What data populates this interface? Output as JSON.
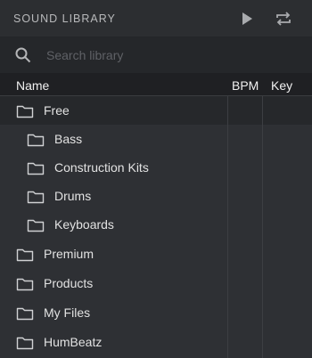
{
  "header": {
    "title": "SOUND LIBRARY"
  },
  "search": {
    "placeholder": "Search library",
    "value": ""
  },
  "columns": {
    "name": "Name",
    "bpm": "BPM",
    "key": "Key"
  },
  "rows": [
    {
      "label": "Free",
      "level": 0,
      "selected": true
    },
    {
      "label": "Bass",
      "level": 1
    },
    {
      "label": "Construction Kits",
      "level": 1
    },
    {
      "label": "Drums",
      "level": 1
    },
    {
      "label": "Keyboards",
      "level": 1
    },
    {
      "label": "Premium",
      "level": 0
    },
    {
      "label": "Products",
      "level": 0
    },
    {
      "label": "My Files",
      "level": 0
    },
    {
      "label": "HumBeatz",
      "level": 0
    }
  ],
  "icons": {
    "play": "play-icon",
    "loop": "loop-icon",
    "search": "search-icon",
    "folder": "folder-icon"
  }
}
